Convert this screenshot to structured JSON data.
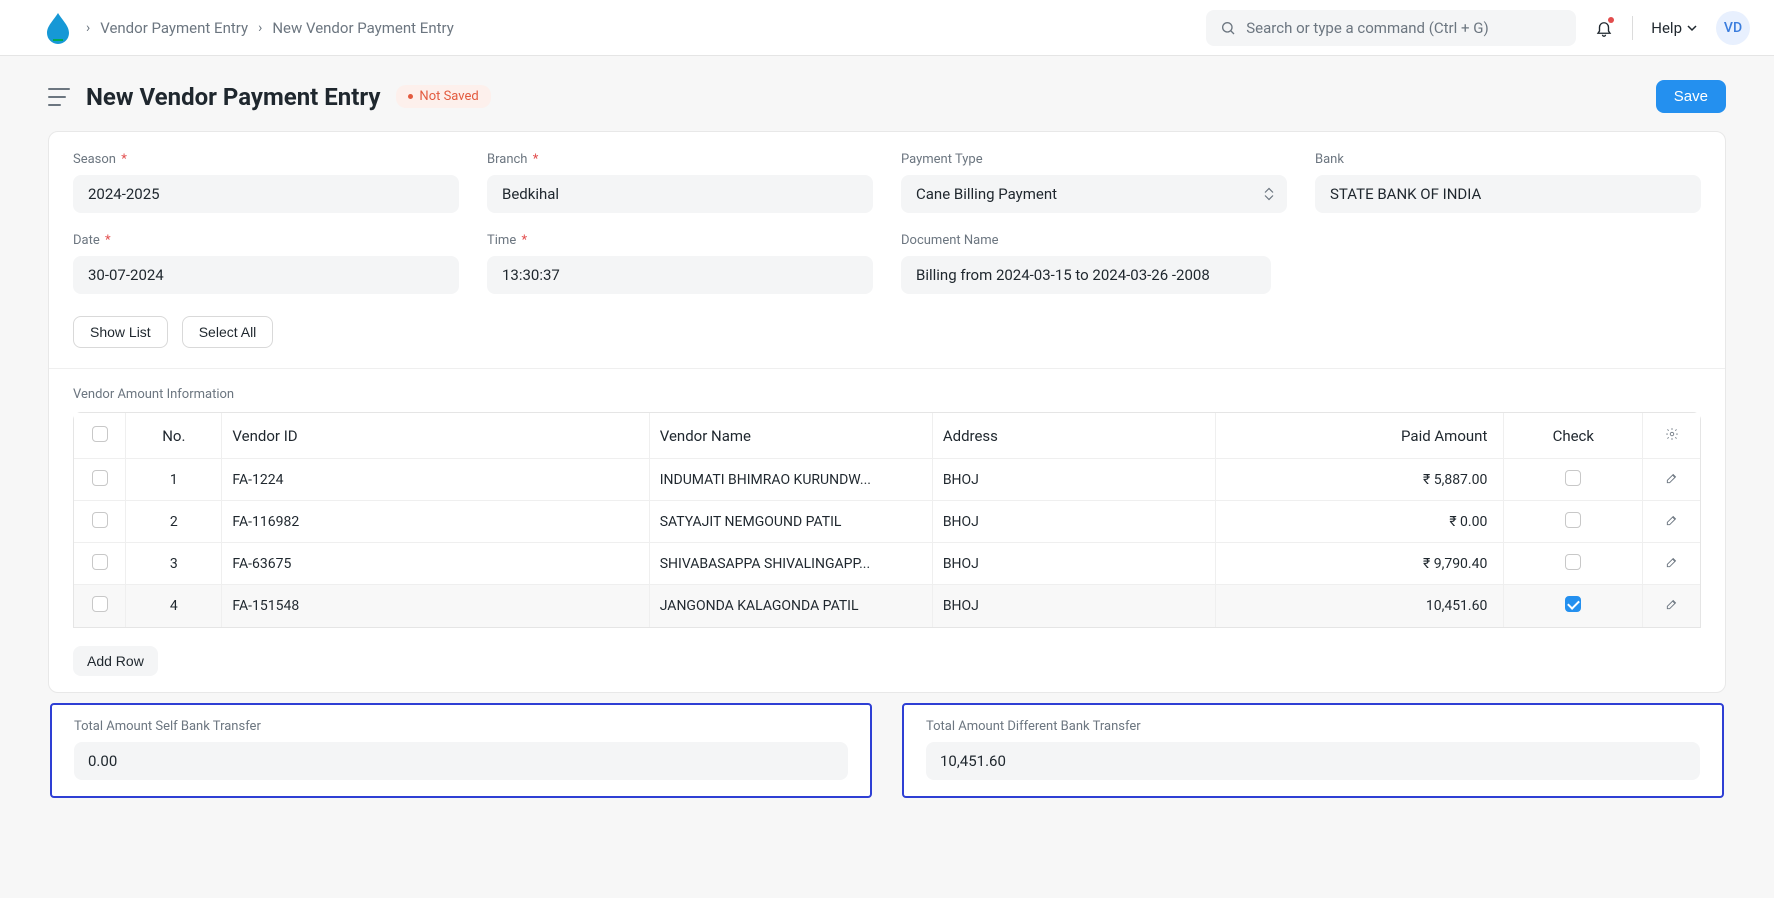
{
  "header": {
    "breadcrumbs": [
      "Vendor Payment Entry",
      "New Vendor Payment Entry"
    ],
    "search_placeholder": "Search or type a command (Ctrl + G)",
    "help_label": "Help",
    "avatar_initials": "VD"
  },
  "page": {
    "title": "New Vendor Payment Entry",
    "status_badge": "Not Saved",
    "save_button": "Save"
  },
  "form": {
    "season": {
      "label": "Season",
      "value": "2024-2025",
      "required": true
    },
    "branch": {
      "label": "Branch",
      "value": "Bedkihal",
      "required": true
    },
    "payment_type": {
      "label": "Payment Type",
      "value": "Cane Billing Payment",
      "required": false
    },
    "bank": {
      "label": "Bank",
      "value": "STATE BANK OF INDIA",
      "required": false
    },
    "date": {
      "label": "Date",
      "value": "30-07-2024",
      "required": true
    },
    "time": {
      "label": "Time",
      "value": "13:30:37",
      "required": true
    },
    "document_name": {
      "label": "Document Name",
      "value": "Billing from 2024-03-15 to 2024-03-26 -2008",
      "required": false
    }
  },
  "buttons": {
    "show_list": "Show List",
    "select_all": "Select All",
    "add_row": "Add Row"
  },
  "table": {
    "section_label": "Vendor Amount Information",
    "columns": {
      "no": "No.",
      "vendor_id": "Vendor ID",
      "vendor_name": "Vendor Name",
      "address": "Address",
      "paid_amount": "Paid Amount",
      "check": "Check"
    },
    "rows": [
      {
        "no": "1",
        "vendor_id": "FA-1224",
        "vendor_name": "INDUMATI BHIMRAO KURUNDW...",
        "address": "BHOJ",
        "paid_amount": "₹ 5,887.00",
        "checked": false
      },
      {
        "no": "2",
        "vendor_id": "FA-116982",
        "vendor_name": "SATYAJIT NEMGOUND PATIL",
        "address": "BHOJ",
        "paid_amount": "₹ 0.00",
        "checked": false
      },
      {
        "no": "3",
        "vendor_id": "FA-63675",
        "vendor_name": "SHIVABASAPPA SHIVALINGAPP...",
        "address": "BHOJ",
        "paid_amount": "₹ 9,790.40",
        "checked": false
      },
      {
        "no": "4",
        "vendor_id": "FA-151548",
        "vendor_name": "JANGONDA KALAGONDA PATIL",
        "address": "BHOJ",
        "paid_amount": "10,451.60",
        "checked": true
      }
    ]
  },
  "totals": {
    "self": {
      "label": "Total Amount Self Bank Transfer",
      "value": "0.00"
    },
    "diff": {
      "label": "Total Amount Different Bank Transfer",
      "value": "10,451.60"
    }
  }
}
